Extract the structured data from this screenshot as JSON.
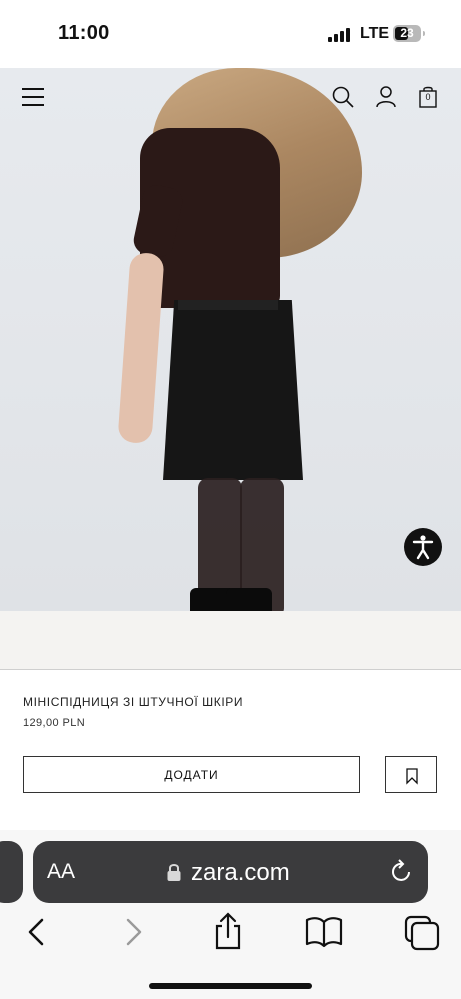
{
  "status_bar": {
    "time": "11:00",
    "network": "LTE",
    "battery": "23",
    "battery_fraction": 0.23
  },
  "header": {
    "icons": [
      "menu-icon",
      "search-icon",
      "user-icon",
      "shopping-bag-icon"
    ],
    "cart_count": "0"
  },
  "product": {
    "name": "МІНІСПІДНИЦЯ ЗІ ШТУЧНОЇ ШКІРИ",
    "price": "129,00 PLN",
    "add_label": "ДОДАТИ",
    "bookmark_icon": "bookmark-icon"
  },
  "accessibility": {
    "icon": "accessibility-icon"
  },
  "browser": {
    "text_size_label": "AA",
    "url": "zara.com",
    "icons": [
      "lock-icon",
      "reload-icon",
      "back-icon",
      "forward-icon",
      "share-icon",
      "bookmarks-icon",
      "tabs-icon"
    ]
  }
}
